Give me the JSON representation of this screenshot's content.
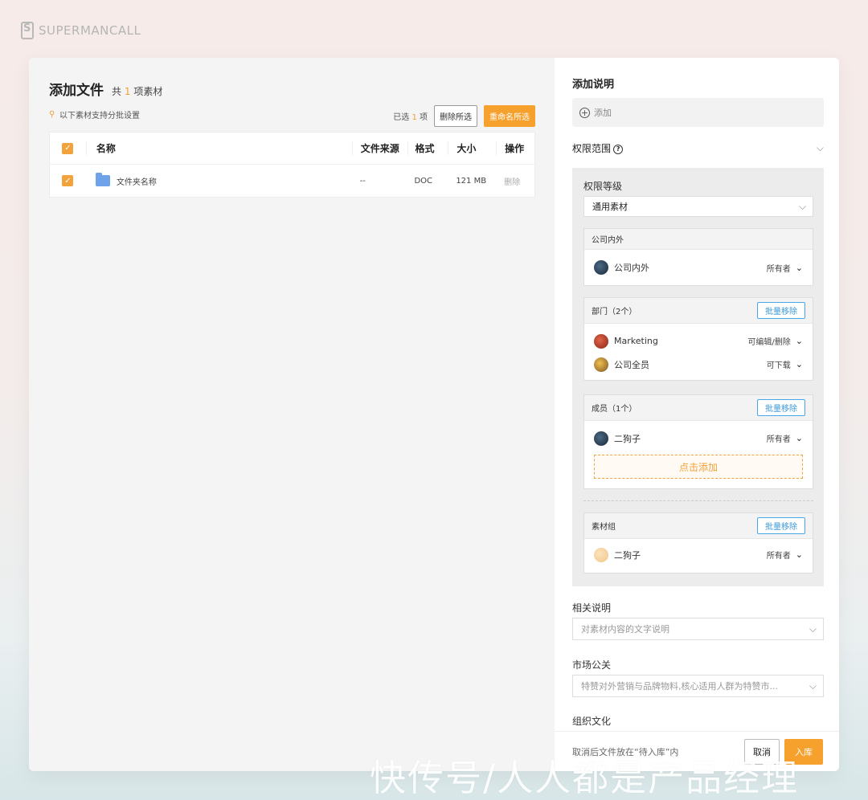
{
  "brand": {
    "name": "SUPERMANCALL"
  },
  "left": {
    "title": "添加文件",
    "count_prefix": "共",
    "count_num": "1",
    "count_suffix": "项素材",
    "tip": "以下素材支持分批设置",
    "selected_prefix": "已选",
    "selected_num": "1",
    "selected_suffix": "项",
    "delete_selected": "删除所选",
    "rename_selected": "重命名所选",
    "table": {
      "headers": {
        "name": "名称",
        "source": "文件来源",
        "format": "格式",
        "size": "大小",
        "op": "操作"
      },
      "rows": [
        {
          "name": "文件夹名称",
          "source": "--",
          "format": "DOC",
          "size": "121 MB",
          "op": "删除"
        }
      ]
    }
  },
  "right": {
    "title": "添加说明",
    "add_label": "添加",
    "scope_label": "权限范围",
    "level_label": "权限等级",
    "level_value": "通用素材",
    "company": {
      "header": "公司内外",
      "rows": [
        {
          "name": "公司内外",
          "perm": "所有者"
        }
      ]
    },
    "dept": {
      "header": "部门（2个）",
      "batch": "批量移除",
      "rows": [
        {
          "name": "Marketing",
          "perm": "可编辑/删除"
        },
        {
          "name": "公司全员",
          "perm": "可下载"
        }
      ]
    },
    "members": {
      "header": "成员（1个）",
      "batch": "批量移除",
      "rows": [
        {
          "name": "二狗子",
          "perm": "所有者"
        }
      ],
      "add_label": "点击添加"
    },
    "groups": {
      "header": "素材组",
      "batch": "批量移除",
      "rows": [
        {
          "name": "二狗子",
          "perm": "所有者"
        }
      ]
    },
    "related": {
      "label": "相关说明",
      "placeholder": "对素材内容的文字说明"
    },
    "market": {
      "label": "市场公关",
      "value": "特赞对外营销与品牌物料,核心适用人群为特赞市..."
    },
    "culture": {
      "label": "组织文化"
    },
    "footer": {
      "tip": "取消后文件放在“待入库”内",
      "cancel": "取消",
      "submit": "入库"
    }
  },
  "watermark": "快传号/人人都是产品经理",
  "colors": {
    "accent": "#f6a02d",
    "link": "#3a98d8"
  }
}
